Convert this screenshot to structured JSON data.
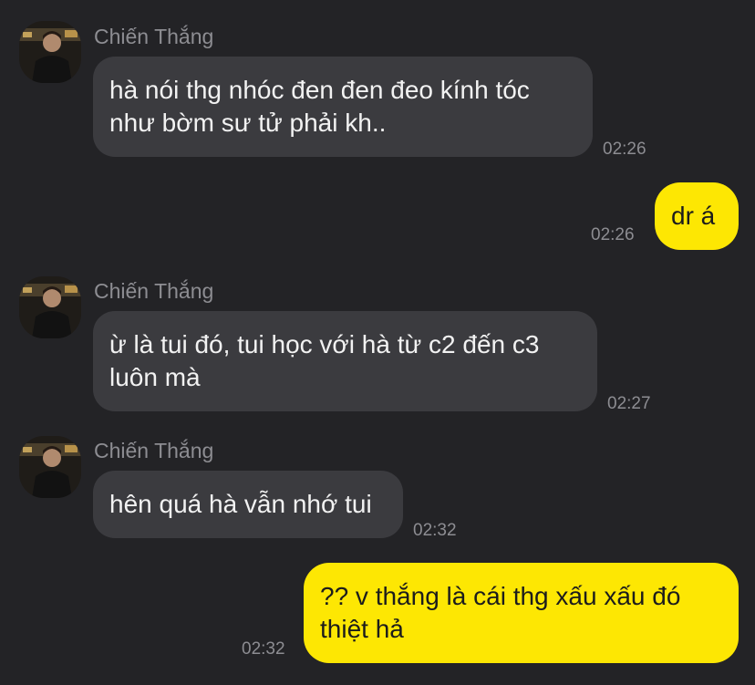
{
  "messages": [
    {
      "id": "m1",
      "direction": "incoming",
      "sender": "Chiến Thắng",
      "lines": [
        "hà nói thg nhóc đen đen đeo kính tóc",
        "như bờm sư tử phải kh.."
      ],
      "time": "02:26",
      "show_avatar": true
    },
    {
      "id": "m2",
      "direction": "outgoing",
      "lines": [
        "dr á"
      ],
      "time": "02:26"
    },
    {
      "id": "m3",
      "direction": "incoming",
      "sender": "Chiến Thắng",
      "lines": [
        "ừ là tui đó, tui học với hà từ c2 đến c3",
        "luôn mà"
      ],
      "time": "02:27",
      "show_avatar": true
    },
    {
      "id": "m4",
      "direction": "incoming",
      "sender": "Chiến Thắng",
      "lines": [
        "hên quá hà vẫn nhớ tui"
      ],
      "time": "02:32",
      "show_avatar": true
    },
    {
      "id": "m5",
      "direction": "outgoing",
      "lines": [
        "?? v thắng là cái thg xấu xấu đó",
        "thiệt hả"
      ],
      "time": "02:32"
    }
  ],
  "colors": {
    "background": "#232326",
    "incoming_bubble": "#3b3b3f",
    "outgoing_bubble": "#fde703",
    "meta_text": "#8d8d92"
  },
  "icons": {
    "avatar": "profile-photo"
  }
}
